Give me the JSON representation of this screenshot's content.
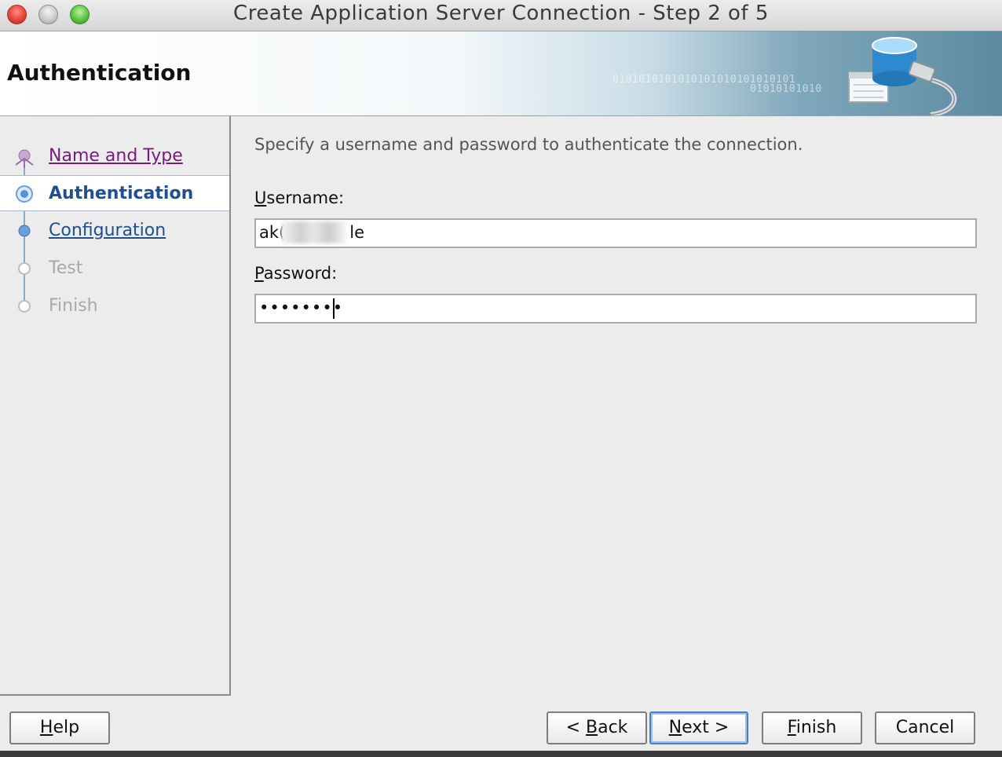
{
  "window": {
    "title": "Create Application Server Connection - Step 2 of 5"
  },
  "banner": {
    "title": "Authentication",
    "binary_line1": "0101010101010101010101010101",
    "binary_line2": "01010101010"
  },
  "steps": [
    {
      "label": "Name and Type",
      "state": "visited"
    },
    {
      "label": "Authentication",
      "state": "current"
    },
    {
      "label": "Configuration",
      "state": "link"
    },
    {
      "label": "Test",
      "state": "disabled"
    },
    {
      "label": "Finish",
      "state": "disabled"
    }
  ],
  "form": {
    "instructions": "Specify a username and password to authenticate the connection.",
    "username_label_mnemonic": "U",
    "username_label_rest": "sername:",
    "username_value_prefix": "ak(",
    "username_value_suffix": "le",
    "password_label_mnemonic": "P",
    "password_label_rest": "assword:",
    "password_value": "••••••••"
  },
  "buttons": {
    "help_mnemonic": "H",
    "help_rest": "elp",
    "back_pre": "< ",
    "back_mnemonic": "B",
    "back_rest": "ack",
    "next_mnemonic": "N",
    "next_rest": "ext >",
    "finish_mnemonic": "F",
    "finish_rest": "inish",
    "cancel": "Cancel"
  },
  "colors": {
    "link": "#1d4f91",
    "visited": "#7a1a7a",
    "disabled": "#a9a9a9",
    "default_button_ring": "#4a7fc1"
  }
}
